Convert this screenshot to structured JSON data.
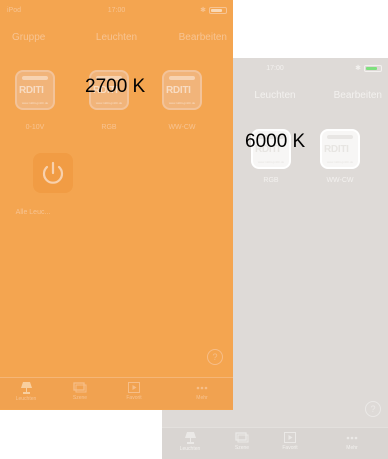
{
  "front": {
    "status": {
      "device": "iPod",
      "time": "17:00",
      "bluetooth": "✱"
    },
    "nav": {
      "left": "Gruppe",
      "title": "Leuchten",
      "right": "Bearbeiten"
    },
    "tiles": [
      {
        "logo": "RDITI",
        "url": "www.rdditi-gmbh.de",
        "label": "0-10V"
      },
      {
        "logo": "RDITI",
        "url": "www.rdditi-gmbh.de",
        "label": "RGB"
      },
      {
        "logo": "RDITI",
        "url": "www.rdditi-gmbh.de",
        "label": "WW-CW"
      }
    ],
    "power_label": "Alle Leuc...",
    "kelvin": "2700 K",
    "tabs": [
      "Leuchten",
      "Szene",
      "Favorit",
      "Mehr"
    ],
    "help": "?"
  },
  "back": {
    "status": {
      "time": "17:00",
      "bluetooth": "✱"
    },
    "nav": {
      "title": "Leuchten",
      "right": "Bearbeiten"
    },
    "tiles": [
      {
        "logo": "RDITI",
        "url": "www.rdditi-gmbh.de",
        "label": "RGB"
      },
      {
        "logo": "RDITI",
        "url": "www.rdditi-gmbh.de",
        "label": "WW-CW"
      }
    ],
    "kelvin": "6000 K",
    "tabs": [
      "Leuchten",
      "Szene",
      "Favorit",
      "Mehr"
    ],
    "help": "?"
  },
  "colors": {
    "warm_background": "#f4a550",
    "cool_background": "#dedad7"
  }
}
